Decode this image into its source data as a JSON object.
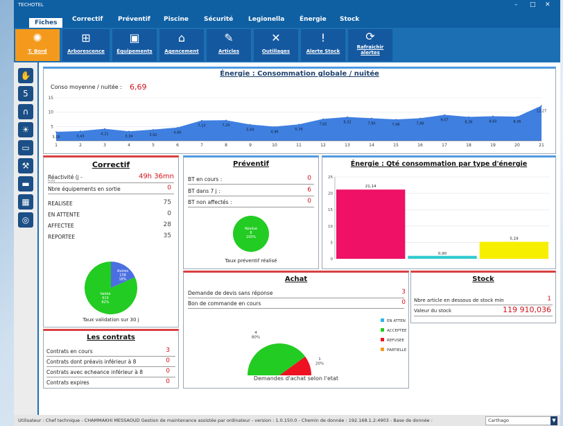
{
  "app_title": "TECHOTEL",
  "window_controls": [
    "–",
    "□",
    "✕"
  ],
  "tabs": [
    "Fiches",
    "Correctif",
    "Préventif",
    "Piscine",
    "Sécurité",
    "Legionella",
    "Énergie",
    "Stock"
  ],
  "ribbon": [
    {
      "label": "T. Bord",
      "icon": "dashboard-icon"
    },
    {
      "label": "Arborescence",
      "icon": "tree-icon"
    },
    {
      "label": "Équipements",
      "icon": "equipment-icon"
    },
    {
      "label": "Agencement",
      "icon": "building-icon"
    },
    {
      "label": "Articles",
      "icon": "pencil-icon"
    },
    {
      "label": "Outillages",
      "icon": "tools-icon"
    },
    {
      "label": "Alerte Stock",
      "icon": "alert-icon"
    },
    {
      "label": "Rafraichir alertes",
      "icon": "refresh-icon"
    }
  ],
  "side_icons": [
    "like-icon",
    "rank-icon",
    "headset-icon",
    "sun-icon",
    "monitor-icon",
    "worker-icon",
    "bed-icon",
    "calendar-icon",
    "camera-icon"
  ],
  "energy": {
    "title": "Énergie : Consommation  globale / nuitée",
    "avg_label": "Conso moyenne / nuitée  :",
    "avg_value": "6,69",
    "chart_data": {
      "type": "area",
      "x": [
        1,
        2,
        3,
        4,
        5,
        6,
        7,
        8,
        9,
        10,
        11,
        12,
        13,
        14,
        15,
        16,
        17,
        18,
        19,
        20,
        21
      ],
      "values": [
        3.16,
        3.43,
        4.21,
        3.34,
        3.92,
        4.66,
        7.1,
        7.2,
        5.69,
        4.96,
        5.76,
        7.65,
        8.32,
        7.9,
        7.46,
        7.88,
        9.07,
        8.36,
        8.6,
        8.45,
        12.27
      ],
      "labels": [
        "3,16",
        "3,43",
        "4,21",
        "3,34",
        "3,92",
        "4,66",
        "7,10",
        "7,20",
        "5,69",
        "4,96",
        "5,76",
        "7,65",
        "8,32",
        "7,90",
        "7,46",
        "7,88",
        "9,07",
        "8,36",
        "8,60",
        "8,45",
        "12,27"
      ],
      "yticks": [
        5,
        10,
        15
      ],
      "ylim": [
        0,
        15
      ],
      "color": "#3f7fe0"
    }
  },
  "correctif": {
    "title": "Correctif",
    "reactivite_label": "Réactivité (j -",
    "reactivite_sub": "h:m)",
    "reactivite_value": "49h 36mn",
    "sortie_label": "Nbre équipements en sortie",
    "sortie_value": "0",
    "stats": [
      {
        "label": "REALISEE",
        "value": "75"
      },
      {
        "label": "EN ATTENTE",
        "value": "0"
      },
      {
        "label": "AFFECTEE",
        "value": "28"
      },
      {
        "label": "REPORTEE",
        "value": "35"
      }
    ],
    "chart_data": {
      "type": "pie",
      "slices": [
        {
          "name": "Autres",
          "value": 138,
          "pct": "18%",
          "color": "#4b6fe0"
        },
        {
          "name": "Validé",
          "value": 615,
          "pct": "82%",
          "color": "#22cc22"
        }
      ]
    },
    "chart_labels": {
      "autres": "Autres\n138\n18%",
      "valide": "Validé\n615\n82%"
    },
    "caption": "Taux validation sur 30 j"
  },
  "preventif": {
    "title": "Préventif",
    "rows": [
      {
        "label": "BT en cours :",
        "value": "0"
      },
      {
        "label": "BT dans 7 j :",
        "value": "6"
      },
      {
        "label": "BT non affectés :",
        "value": "0"
      }
    ],
    "chart_data": {
      "type": "pie",
      "slices": [
        {
          "name": "Réalisé",
          "value": 8,
          "pct": "100%",
          "color": "#22cc22"
        }
      ]
    },
    "chart_label": "Réalisé\n8\n100%",
    "caption": "Taux préventif réalisé"
  },
  "energie_type": {
    "title": "Énergie : Qté consommation par type d'énergie",
    "chart_data": {
      "type": "bar",
      "values": [
        21.14,
        0.9,
        5.19
      ],
      "labels": [
        "21,14",
        "0,90",
        "5,19"
      ],
      "colors": [
        "#ee1166",
        "#33ccd0",
        "#f7ef00"
      ],
      "ylim": [
        0,
        25
      ],
      "yticks": [
        0,
        5,
        10,
        15,
        20,
        25
      ]
    }
  },
  "achat": {
    "title": "Achat",
    "rows": [
      {
        "label": "Demande de devis sans réponse",
        "value": "3"
      },
      {
        "label": "Bon de commande en cours",
        "value": "0"
      }
    ],
    "chart_data": {
      "type": "pie",
      "slices": [
        {
          "name": "ACCEPTEE",
          "value": 4,
          "pct": "80%",
          "color": "#22cc22"
        },
        {
          "name": "REFUSEE",
          "value": 1,
          "pct": "20%",
          "color": "#ee1122"
        }
      ]
    },
    "label_accepted": "4\n80%",
    "label_refused": "1\n20%",
    "legend": [
      {
        "label": "EN ATTEN",
        "color": "#2ab9e8"
      },
      {
        "label": "ACCEPTEE",
        "color": "#22cc22"
      },
      {
        "label": "REFUSEE",
        "color": "#ee1122"
      },
      {
        "label": "PARTIELLE",
        "color": "#f59a1b"
      }
    ],
    "caption": "Demandes d'achat selon l'etat"
  },
  "stock": {
    "title": "Stock",
    "rows": [
      {
        "label": "Nbre article en dessous de stock min",
        "value": "1"
      },
      {
        "label": "Valeur du stock",
        "value": "119 910,036"
      }
    ]
  },
  "contrats": {
    "title": "Les contrats",
    "rows": [
      {
        "label": "Contrats en cours",
        "value": "3"
      },
      {
        "label": "Contrats dont préavis inférieur à 8",
        "value": "0"
      },
      {
        "label": "Contrats avec echeance inférieur à 8",
        "value": "0"
      },
      {
        "label": "Contrats expires",
        "value": "0"
      }
    ]
  },
  "status": {
    "text": "Utilisateur : Chef technique - CHAMMAKHI MESSAOUD    Gestion de maintenance assistée par ordinateur - version : 1.0.150.0 - Chemin de donnée : 192.168.1.2:4903 - Base de donnée :",
    "db": "Carthago"
  }
}
